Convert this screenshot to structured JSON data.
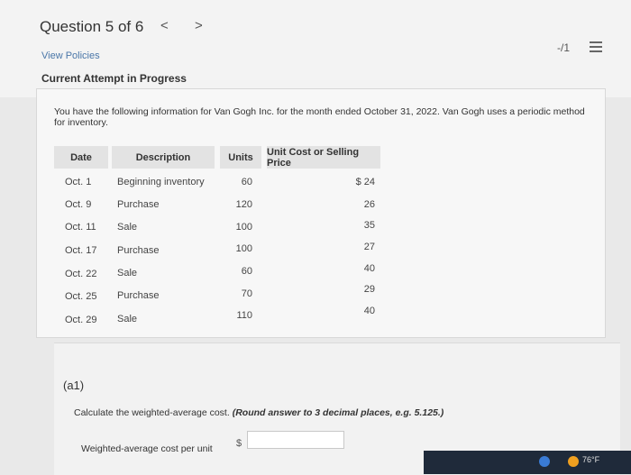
{
  "header": {
    "question_counter": "Question 5 of 6",
    "prev": "<",
    "next": ">",
    "score": "-/1",
    "view_policies": "View Policies",
    "attempt_status": "Current Attempt in Progress"
  },
  "problem": {
    "intro": "You have the following information for Van Gogh Inc. for the month ended October 31, 2022. Van Gogh uses a periodic method for inventory.",
    "columns": [
      "Date",
      "Description",
      "Units",
      "Unit Cost or Selling Price"
    ],
    "rows": [
      {
        "date": "Oct. 1",
        "description": "Beginning inventory",
        "units": "60",
        "price": "$ 24"
      },
      {
        "date": "Oct. 9",
        "description": "Purchase",
        "units": "120",
        "price": "26"
      },
      {
        "date": "Oct. 11",
        "description": "Sale",
        "units": "100",
        "price": "35"
      },
      {
        "date": "Oct. 17",
        "description": "Purchase",
        "units": "100",
        "price": "27"
      },
      {
        "date": "Oct. 22",
        "description": "Sale",
        "units": "60",
        "price": "40"
      },
      {
        "date": "Oct. 25",
        "description": "Purchase",
        "units": "70",
        "price": "29"
      },
      {
        "date": "Oct. 29",
        "description": "Sale",
        "units": "110",
        "price": "40"
      }
    ]
  },
  "part_a1": {
    "label": "(a1)",
    "instruction": "Calculate the weighted-average cost.",
    "instruction_note": "(Round answer to 3 decimal places, e.g. 5.125.)",
    "field_label": "Weighted-average cost per unit",
    "currency": "$",
    "answer_value": ""
  },
  "taskbar": {
    "temperature": "76°F"
  },
  "colors": {
    "link": "#4a76a8",
    "header_bg": "#e3e3e3"
  }
}
